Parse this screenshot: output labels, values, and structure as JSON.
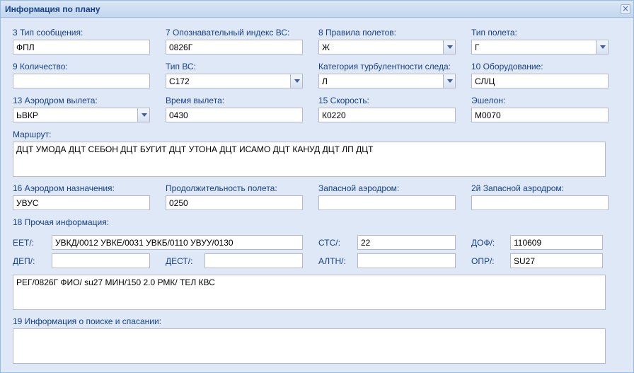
{
  "window": {
    "title": "Информация по плану"
  },
  "row1": {
    "msg_type_label": "3 Тип сообщения:",
    "msg_type_value": "ФПЛ",
    "callsign_label": "7 Опознавательный индекс ВС:",
    "callsign_value": "0826Г",
    "flight_rules_label": "8 Правила полетов:",
    "flight_rules_value": "Ж",
    "flight_type_label": "Тип полета:",
    "flight_type_value": "Г"
  },
  "row2": {
    "count_label": "9 Количество:",
    "count_value": "",
    "aircraft_type_label": "Тип ВС:",
    "aircraft_type_value": "С172",
    "turbulence_label": "Категория турбулентности следа:",
    "turbulence_value": "Л",
    "equipment_label": "10 Оборудование:",
    "equipment_value": "СЛ/Ц"
  },
  "row3": {
    "dep_aero_label": "13 Аэродром вылета:",
    "dep_aero_value": "ЬВКР",
    "dep_time_label": "Время вылета:",
    "dep_time_value": "0430",
    "speed_label": "15 Скорость:",
    "speed_value": "К0220",
    "level_label": "Эшелон:",
    "level_value": "М0070"
  },
  "route": {
    "label": "Маршрут:",
    "value": "ДЦТ УМОДА ДЦТ СЕБОН ДЦТ БУГИТ ДЦТ УТОНА ДЦТ ИСАМО ДЦТ КАНУД ДЦТ ЛП ДЦТ"
  },
  "row4": {
    "dest_label": "16 Аэродром назначения:",
    "dest_value": "УВУС",
    "duration_label": "Продолжительность полета:",
    "duration_value": "0250",
    "alt_label": "Запасной аэродром:",
    "alt_value": "",
    "alt2_label": "2й Запасной аэродром:",
    "alt2_value": ""
  },
  "other": {
    "label": "18 Прочая информация:",
    "eet_label": "ЕЕТ/:",
    "eet_value": "УВКД/0012 УВКЕ/0031 УВКБ/0110 УВУУ/0130",
    "sts_label": "СТС/:",
    "sts_value": "22",
    "dof_label": "ДОФ/:",
    "dof_value": "110609",
    "dep_label": "ДЕП/:",
    "dep_value": "",
    "dest_label": "ДЕСТ/:",
    "dest_value": "",
    "altn_label": "АЛТН/:",
    "altn_value": "",
    "opr_label": "ОПР/:",
    "opr_value": "SU27",
    "remarks_value": "РЕГ/0826Г ФИО/ su27 МИН/150 2.0 РМК/ ТЕЛ КВС"
  },
  "sar": {
    "label": "19 Информация о поиске и спасании:",
    "value": ""
  },
  "icons": {
    "close": "close-icon",
    "dropdown": "chevron-down-icon"
  }
}
